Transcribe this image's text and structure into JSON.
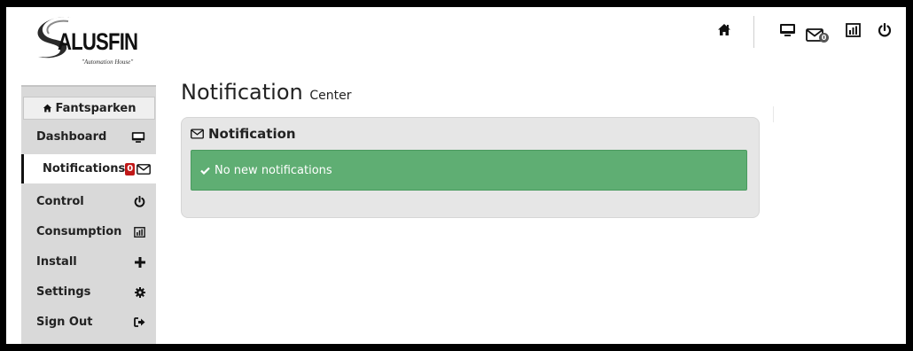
{
  "brand": {
    "name": "ALUSFIN",
    "tagline": "\"Automation House\""
  },
  "topbar": {
    "home_icon": "home-icon",
    "monitor_icon": "monitor-icon",
    "mail_icon": "envelope-icon",
    "mail_count": "0",
    "chart_icon": "bar-chart-icon",
    "power_icon": "power-icon"
  },
  "sidebar": {
    "header": "Fantsparken",
    "header_icon": "home-icon",
    "items": [
      {
        "label": "Dashboard",
        "icon": "monitor-icon"
      },
      {
        "label": "Notifications",
        "icon": "envelope-icon",
        "badge": "0",
        "active": true
      },
      {
        "label": "Control",
        "icon": "power-icon"
      },
      {
        "label": "Consumption",
        "icon": "bar-chart-icon"
      },
      {
        "label": "Install",
        "icon": "plus-icon"
      },
      {
        "label": "Settings",
        "icon": "gear-icon"
      },
      {
        "label": "Sign Out",
        "icon": "sign-out-icon"
      }
    ]
  },
  "main": {
    "title": "Notification",
    "subtitle": "Center",
    "panel": {
      "title": "Notification",
      "alert": "No new notifications"
    }
  },
  "colors": {
    "alert_green": "#5fae73",
    "badge_red": "#c01818",
    "sidebar_gray": "#d9d9d9",
    "panel_gray": "#e6e6e6"
  }
}
